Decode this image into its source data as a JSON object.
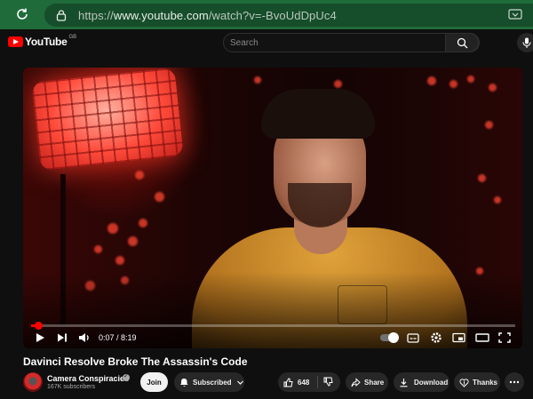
{
  "browser": {
    "url_prefix": "https://",
    "url_main": "www.youtube.com",
    "url_path": "/watch?v=-BvoUdDpUc4"
  },
  "header": {
    "logo_text": "YouTube",
    "region": "GB",
    "search_placeholder": "Search"
  },
  "player": {
    "current_time": "0:07 / 8:19",
    "progress": 0.014,
    "shirt_print": "CAMERA CONSPIRACIES"
  },
  "video": {
    "title": "Davinci Resolve Broke The Assassin's Code"
  },
  "channel": {
    "name": "Camera Conspiracies",
    "subscribers": "167K subscribers"
  },
  "actions": {
    "join": "Join",
    "subscribed": "Subscribed",
    "likes": "648",
    "share": "Share",
    "download": "Download",
    "thanks": "Thanks"
  },
  "icons": [
    "reload-icon",
    "lock-icon",
    "cast-icon",
    "search-icon",
    "mic-icon",
    "play-icon",
    "next-icon",
    "volume-icon",
    "captions-icon",
    "settings-icon",
    "miniplayer-icon",
    "theater-icon",
    "fullscreen-icon",
    "bell-icon",
    "chevron-down-icon",
    "like-icon",
    "dislike-icon",
    "share-icon",
    "download-icon",
    "thanks-icon",
    "more-icon"
  ],
  "colors": {
    "browser_bar": "#1f6b3a",
    "youtube_red": "#ff0000",
    "page_bg": "#0f0f0f",
    "pill_bg": "#272727"
  }
}
